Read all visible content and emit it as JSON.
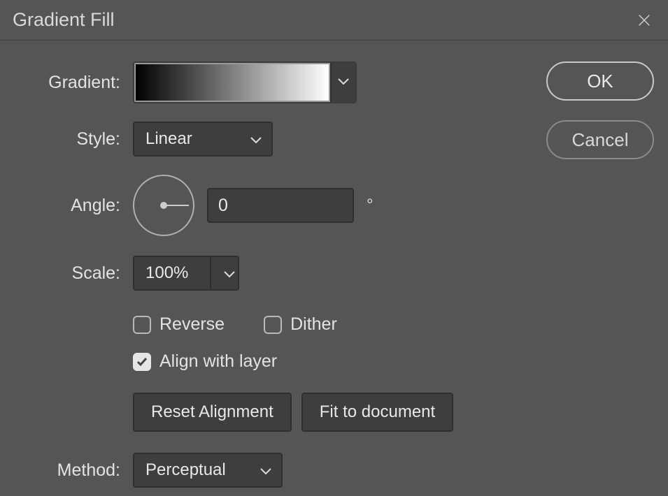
{
  "title": "Gradient Fill",
  "buttons": {
    "ok": "OK",
    "cancel": "Cancel"
  },
  "gradient": {
    "label": "Gradient:",
    "stops": [
      {
        "color": "#000000",
        "pos": 0
      },
      {
        "color": "#ffffff",
        "pos": 100
      }
    ]
  },
  "style": {
    "label": "Style:",
    "value": "Linear"
  },
  "angle": {
    "label": "Angle:",
    "value": "0",
    "unit": "°",
    "dial_deg": 0
  },
  "scale": {
    "label": "Scale:",
    "value": "100%"
  },
  "checks": {
    "spacer": "x",
    "reverse": "Reverse",
    "dither": "Dither",
    "align": "Align with layer",
    "reverse_on": false,
    "dither_on": false,
    "align_on": true
  },
  "align_btns": {
    "spacer": "x",
    "reset": "Reset Alignment",
    "fit": "Fit to document"
  },
  "method": {
    "label": "Method:",
    "value": "Perceptual"
  }
}
